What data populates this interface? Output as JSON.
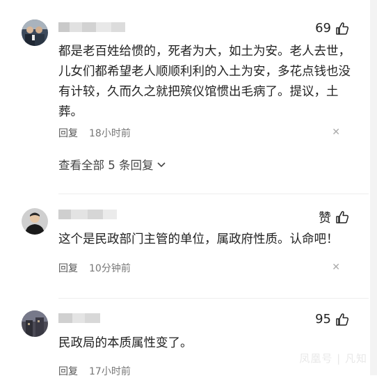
{
  "comments": [
    {
      "likes": "69",
      "text": "都是老百姓给惯的，死者为大，如土为安。老人去世，儿女们都希望老人顺顺利利的入土为安，多花点钱也没有计较，久而久之就把殡仪馆惯出毛病了。提议，土葬。",
      "reply_label": "回复",
      "time": "18小时前",
      "view_all": "查看全部 5 条回复"
    },
    {
      "likes": "赞",
      "text": "这个是民政部门主管的单位，属政府性质。认命吧！",
      "reply_label": "回复",
      "time": "10分钟前"
    },
    {
      "likes": "95",
      "text": "民政局的本质属性变了。",
      "reply_label": "回复",
      "time": "17小时前"
    }
  ],
  "icons": {
    "like": "thumbs-up-icon",
    "close": "close-x-icon",
    "expand": "chevron-down-icon"
  },
  "watermark": "凤凰号 | 凡知"
}
